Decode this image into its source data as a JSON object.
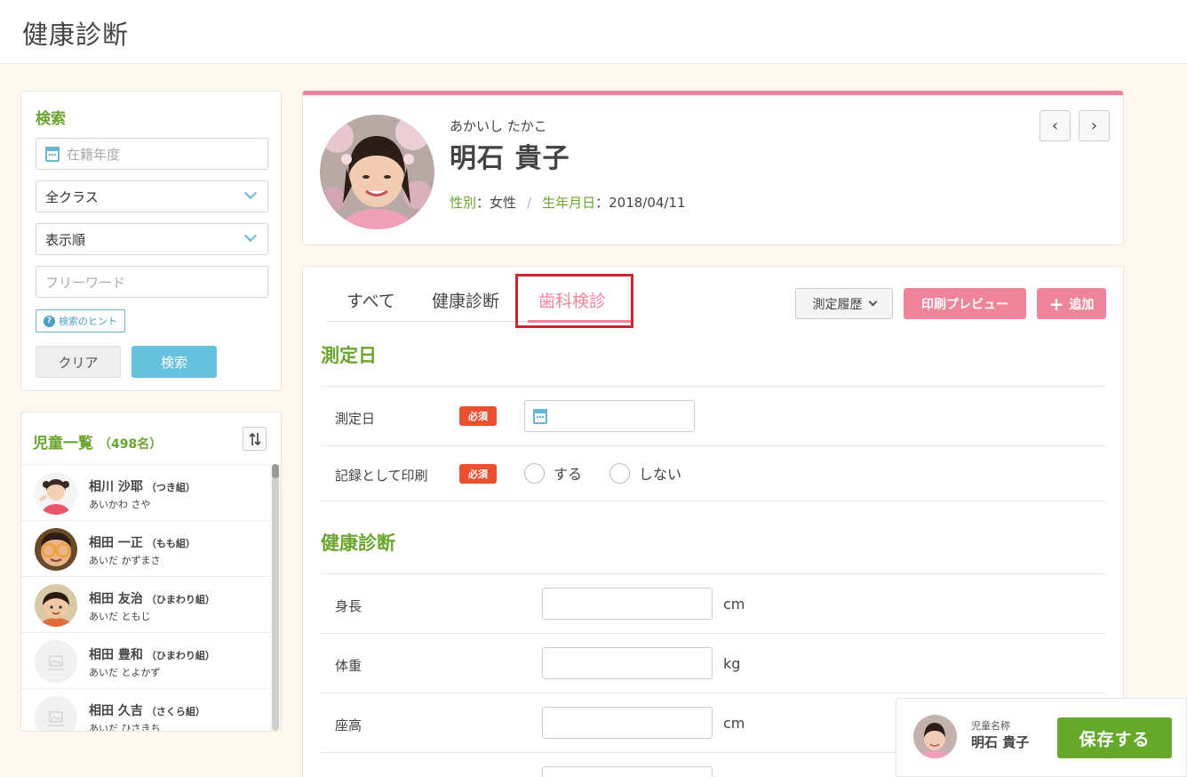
{
  "page": {
    "title": "健康診断"
  },
  "search": {
    "title": "検索",
    "year_placeholder": "在籍年度",
    "class_select": "全クラス",
    "order_select": "表示順",
    "freeword_placeholder": "フリーワード",
    "hint_label": "検索のヒント",
    "clear_label": "クリア",
    "search_label": "検索"
  },
  "child_list": {
    "title": "児童一覧",
    "count": "（498名）",
    "items": [
      {
        "name": "相川 沙耶",
        "class": "（つき組）",
        "kana": "あいかわ さや",
        "avatar": "photo-girl"
      },
      {
        "name": "相田 一正",
        "class": "（もも組）",
        "kana": "あいだ かずまさ",
        "avatar": "photo-boy-glasses"
      },
      {
        "name": "相田 友治",
        "class": "（ひまわり組）",
        "kana": "あいだ ともじ",
        "avatar": "photo-boy"
      },
      {
        "name": "相田 豊和",
        "class": "（ひまわり組）",
        "kana": "あいだ とよかず",
        "avatar": "no-image"
      },
      {
        "name": "相田 久吉",
        "class": "（さくら組）",
        "kana": "あいだ ひさきち",
        "avatar": "no-image"
      }
    ]
  },
  "profile": {
    "kana": "あかいし たかこ",
    "name": "明石 貴子",
    "gender_label": "性別",
    "gender_value": "：女性",
    "birth_label": "生年月日",
    "birth_value": "：2018/04/11",
    "prev_label": "‹",
    "next_label": "›"
  },
  "tabs": {
    "all": "すべて",
    "health": "健康診断",
    "dental": "歯科検診",
    "active": "dental"
  },
  "toolbar": {
    "history_label": "測定履歴",
    "print_label": "印刷プレビュー",
    "add_label": "追加"
  },
  "form": {
    "date_section": "測定日",
    "date_label": "測定日",
    "required": "必須",
    "print_label": "記録として印刷",
    "radio_yes": "する",
    "radio_no": "しない",
    "health_section": "健康診断",
    "height_label": "身長",
    "height_unit": "cm",
    "weight_label": "体重",
    "weight_unit": "kg",
    "sitting_label": "座高",
    "sitting_unit": "cm"
  },
  "save_bar": {
    "label": "児童名称",
    "name": "明石 貴子",
    "save_label": "保存する"
  },
  "colors": {
    "accent_green": "#6aa52e",
    "accent_pink": "#f0849a",
    "accent_blue": "#67c0dc",
    "required_red": "#e8502f",
    "highlight_red": "#d0232b"
  }
}
